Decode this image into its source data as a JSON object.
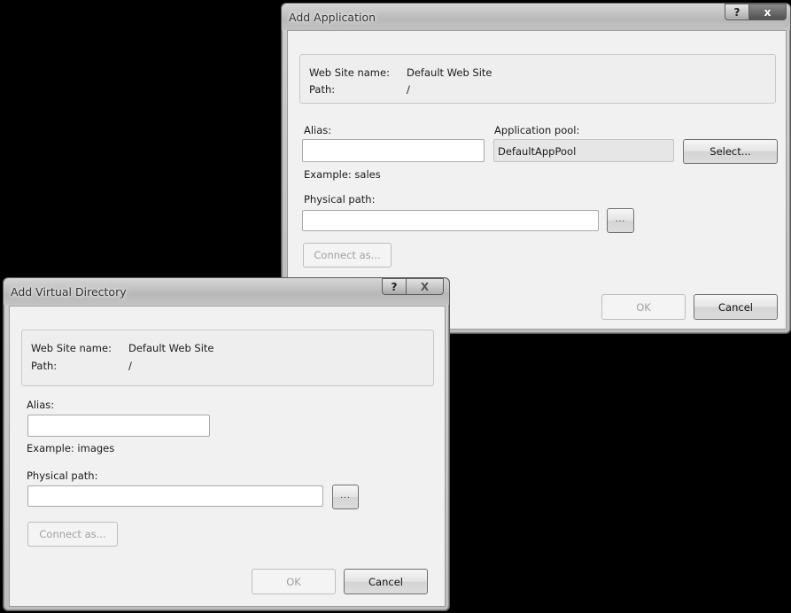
{
  "add_application": {
    "title": "Add Application",
    "help_glyph": "?",
    "close_glyph": "x",
    "info": {
      "site_label": "Web Site name:",
      "site_value": "Default Web Site",
      "path_label": "Path:",
      "path_value": "/"
    },
    "alias_label": "Alias:",
    "alias_value": "",
    "alias_example": "Example: sales",
    "app_pool_label": "Application pool:",
    "app_pool_value": "DefaultAppPool",
    "select_button": "Select...",
    "physical_path_label": "Physical path:",
    "physical_path_value": "",
    "browse_button": "...",
    "connect_as_button": "Connect as...",
    "ok_button": "OK",
    "cancel_button": "Cancel"
  },
  "add_virtual_directory": {
    "title": "Add Virtual Directory",
    "help_glyph": "?",
    "close_glyph": "X",
    "info": {
      "site_label": "Web Site name:",
      "site_value": "Default Web Site",
      "path_label": "Path:",
      "path_value": "/"
    },
    "alias_label": "Alias:",
    "alias_value": "",
    "alias_example": "Example: images",
    "physical_path_label": "Physical path:",
    "physical_path_value": "",
    "browse_button": "...",
    "connect_as_button": "Connect as...",
    "ok_button": "OK",
    "cancel_button": "Cancel"
  }
}
